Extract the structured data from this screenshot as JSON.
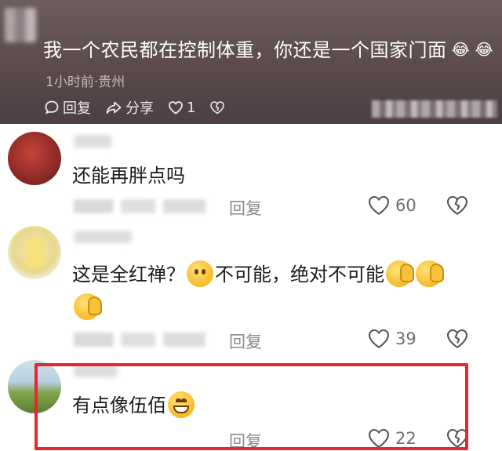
{
  "top_comment": {
    "text": "我一个农民都在控制体重，你还是一个国家门面",
    "emojis": [
      "😂",
      "😂"
    ],
    "meta": "1小时前·贵州",
    "reply_label": "回复",
    "share_label": "分享",
    "like_count": "1"
  },
  "comments": [
    {
      "text": "还能再胖点吗",
      "reply_label": "回复",
      "like_count": "60"
    },
    {
      "text_part1": "这是全红禅？",
      "text_part2": "不可能，绝对不可能",
      "reply_label": "回复",
      "like_count": "39"
    },
    {
      "text": "有点像伍佰",
      "reply_label": "回复",
      "like_count": "22"
    }
  ],
  "colors": {
    "highlight_box": "#e8262d",
    "top_card": "#5a4a4c"
  }
}
